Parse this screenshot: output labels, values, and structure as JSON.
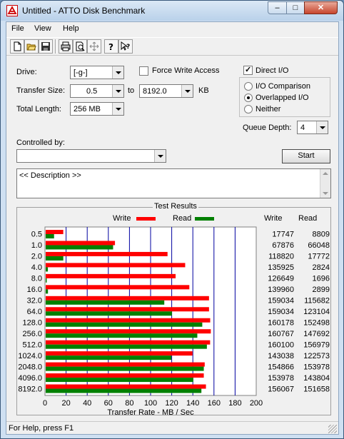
{
  "window": {
    "title": "Untitled - ATTO Disk Benchmark",
    "min_glyph": "–",
    "max_glyph": "□",
    "close_glyph": "✕"
  },
  "menu": [
    "File",
    "View",
    "Help"
  ],
  "toolbar": [
    "new-file-icon",
    "open-folder-icon",
    "save-icon",
    "print-icon",
    "print-preview-icon",
    "move-icon",
    "help-icon",
    "context-help-icon"
  ],
  "form": {
    "drive_label": "Drive:",
    "drive_value": "[-g-]",
    "force_write_label": "Force Write Access",
    "force_write_checked": false,
    "direct_io_label": "Direct I/O",
    "direct_io_checked": true,
    "transfer_size_label": "Transfer Size:",
    "transfer_from": "0.5",
    "to_label": "to",
    "transfer_to": "8192.0",
    "kb_label": "KB",
    "total_length_label": "Total Length:",
    "total_length_value": "256 MB",
    "radio_options": [
      "I/O Comparison",
      "Overlapped I/O",
      "Neither"
    ],
    "radio_selected": 1,
    "queue_depth_label": "Queue Depth:",
    "queue_depth_value": "4",
    "controlled_by_label": "Controlled by:",
    "controlled_by_value": "",
    "start_label": "Start",
    "description_text": "<< Description >>"
  },
  "results": {
    "group_title": "Test Results",
    "legend_write": "Write",
    "legend_read": "Read",
    "col_write": "Write",
    "col_read": "Read"
  },
  "status": {
    "text": "For Help, press F1"
  },
  "colors": {
    "write": "#ff0000",
    "read": "#008000",
    "gridline": "#0000a0"
  },
  "chart_data": {
    "type": "bar",
    "orientation": "horizontal",
    "title": "Test Results",
    "xlabel": "Transfer Rate - MB / Sec",
    "xlim": [
      0,
      200
    ],
    "xticks": [
      0,
      20,
      40,
      60,
      80,
      100,
      120,
      140,
      160,
      180,
      200
    ],
    "grid": true,
    "legend_position": "top",
    "categories": [
      "0.5",
      "1.0",
      "2.0",
      "4.0",
      "8.0",
      "16.0",
      "32.0",
      "64.0",
      "128.0",
      "256.0",
      "512.0",
      "1024.0",
      "2048.0",
      "4096.0",
      "8192.0"
    ],
    "series": [
      {
        "name": "Write",
        "unit": "KB/s",
        "values": [
          17747,
          67876,
          118820,
          135925,
          126649,
          139960,
          159034,
          159034,
          160178,
          160767,
          160100,
          143038,
          154866,
          153978,
          156067
        ]
      },
      {
        "name": "Read",
        "unit": "KB/s",
        "values": [
          8809,
          66048,
          17772,
          2824,
          1696,
          2899,
          115682,
          123104,
          152498,
          147692,
          156979,
          122573,
          153978,
          143804,
          151658
        ]
      }
    ]
  }
}
